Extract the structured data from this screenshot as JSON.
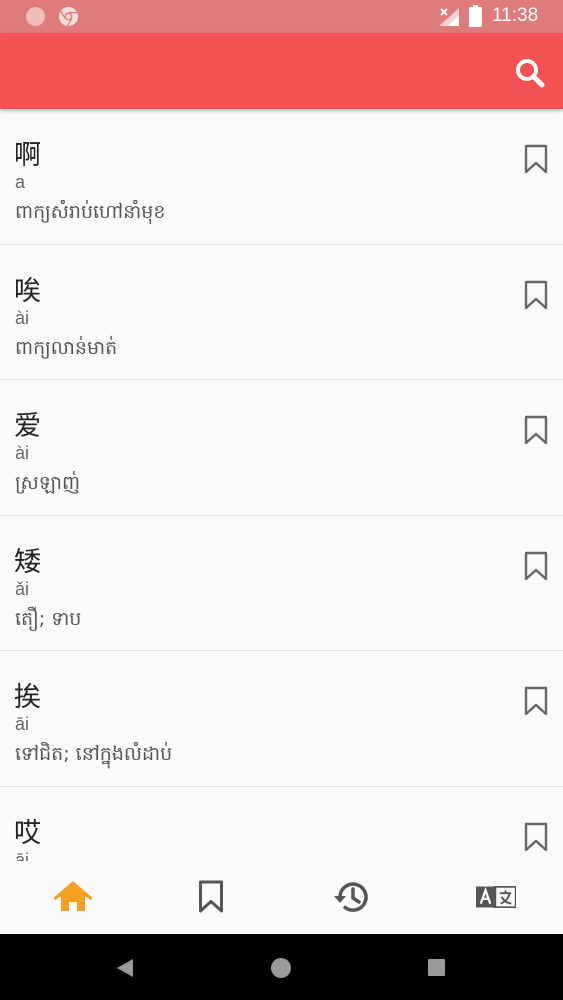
{
  "status_bar": {
    "time": "11:38",
    "icons": [
      "notification-dot-icon",
      "chrome-icon",
      "signal-no-data-icon",
      "battery-icon"
    ]
  },
  "app_bar": {
    "background": "#f45252",
    "search_icon": "search-icon"
  },
  "entries": [
    {
      "hanzi": "啊",
      "pinyin": "a",
      "meaning": "ពាក្យសំរាប់ហៅនាំមុខ"
    },
    {
      "hanzi": "唉",
      "pinyin": "ài",
      "meaning": "ពាក្យលាន់មាត់"
    },
    {
      "hanzi": "爱",
      "pinyin": "ài",
      "meaning": "ស្រឡាញ់"
    },
    {
      "hanzi": "矮",
      "pinyin": "ǎi",
      "meaning": "តឿ; ទាប"
    },
    {
      "hanzi": "挨",
      "pinyin": "āi",
      "meaning": "ទៅជិត; នៅក្នុងលំដាប់"
    },
    {
      "hanzi": "哎",
      "pinyin": "āi",
      "meaning": ""
    }
  ],
  "bottom_nav": {
    "active_color": "#f5a020",
    "inactive_color": "#555555",
    "items": [
      {
        "name": "home",
        "icon": "home-icon",
        "active": true
      },
      {
        "name": "bookmarks",
        "icon": "bookmark-icon",
        "active": false
      },
      {
        "name": "history",
        "icon": "history-icon",
        "active": false
      },
      {
        "name": "translate",
        "icon": "translate-icon",
        "active": false
      }
    ]
  }
}
